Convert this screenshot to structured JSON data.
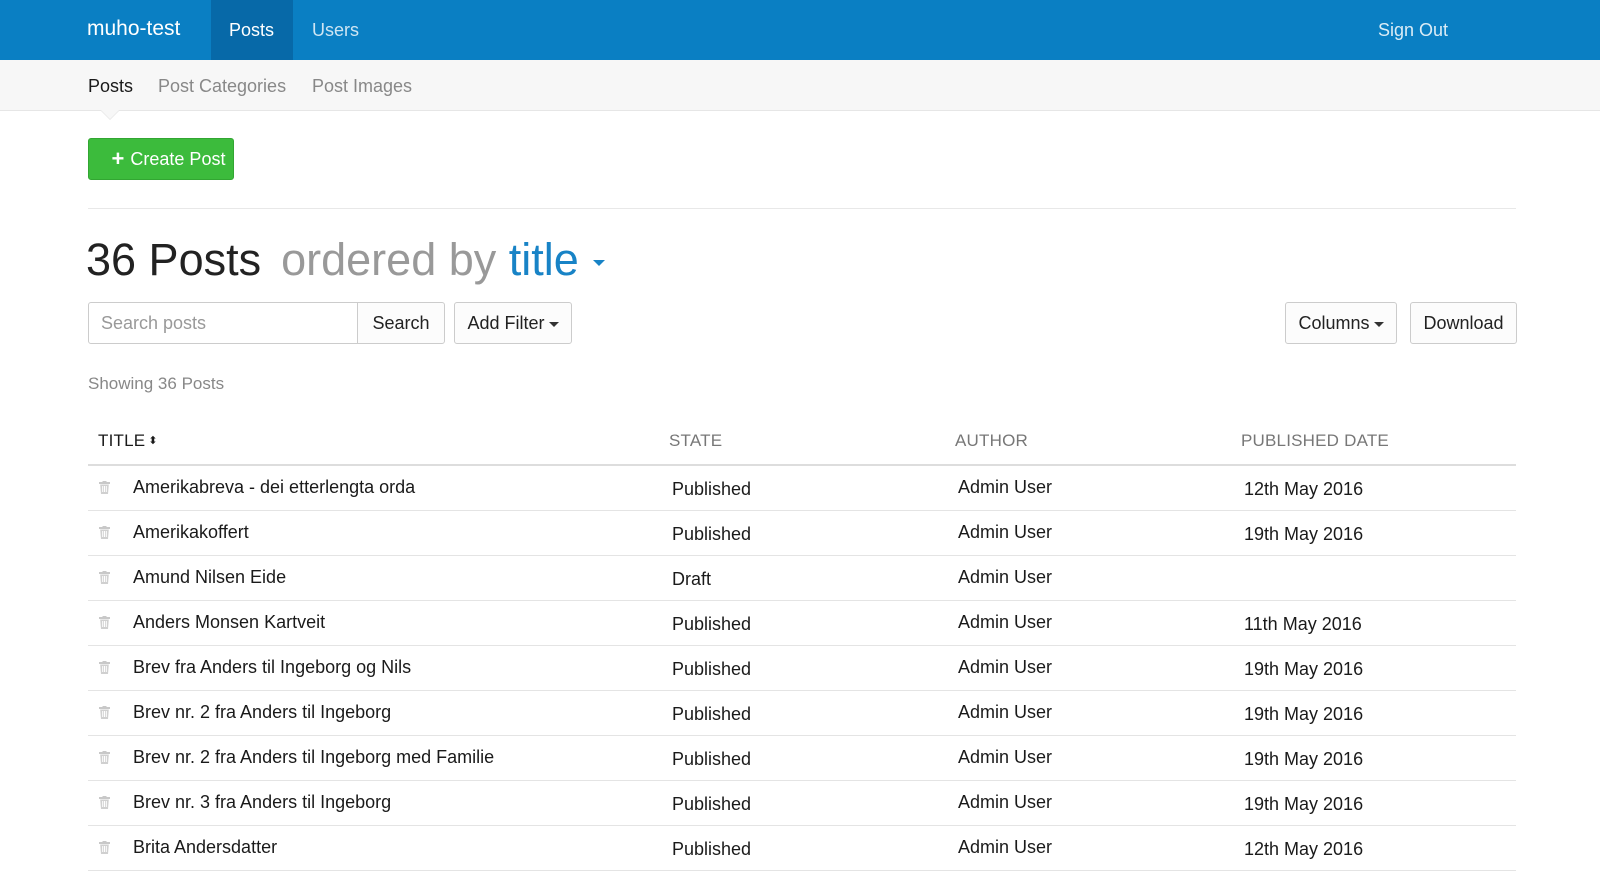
{
  "topbar": {
    "brand": "muho-test",
    "nav": [
      {
        "label": "Posts",
        "active": true
      },
      {
        "label": "Users",
        "active": false
      }
    ],
    "sign_out": "Sign Out",
    "color": "#0a7fc3"
  },
  "subnav": {
    "items": [
      {
        "label": "Posts",
        "active": true
      },
      {
        "label": "Post Categories",
        "active": false
      },
      {
        "label": "Post Images",
        "active": false
      }
    ]
  },
  "toolbar": {
    "create_label": "Create Post",
    "create_color": "#3cbb3c"
  },
  "heading": {
    "count_text": "36 Posts",
    "ordered_text": "ordered by",
    "sort_field": "title"
  },
  "search": {
    "placeholder": "Search posts",
    "value": "",
    "button_label": "Search",
    "add_filter_label": "Add Filter",
    "columns_label": "Columns",
    "download_label": "Download"
  },
  "list": {
    "showing": "Showing 36 Posts",
    "columns": [
      "TITLE",
      "STATE",
      "AUTHOR",
      "PUBLISHED DATE"
    ],
    "rows": [
      {
        "title": "Amerikabreva - dei etterlengta orda",
        "state": "Published",
        "author": "Admin User",
        "date": "12th May 2016"
      },
      {
        "title": "Amerikakoffert",
        "state": "Published",
        "author": "Admin User",
        "date": "19th May 2016"
      },
      {
        "title": "Amund Nilsen Eide",
        "state": "Draft",
        "author": "Admin User",
        "date": ""
      },
      {
        "title": "Anders Monsen Kartveit",
        "state": "Published",
        "author": "Admin User",
        "date": "11th May 2016"
      },
      {
        "title": "Brev fra Anders til Ingeborg og Nils",
        "state": "Published",
        "author": "Admin User",
        "date": "19th May 2016"
      },
      {
        "title": "Brev nr. 2 fra Anders til Ingeborg",
        "state": "Published",
        "author": "Admin User",
        "date": "19th May 2016"
      },
      {
        "title": "Brev nr. 2 fra Anders til Ingeborg med Familie",
        "state": "Published",
        "author": "Admin User",
        "date": "19th May 2016"
      },
      {
        "title": "Brev nr. 3 fra Anders til Ingeborg",
        "state": "Published",
        "author": "Admin User",
        "date": "19th May 2016"
      },
      {
        "title": "Brita Andersdatter",
        "state": "Published",
        "author": "Admin User",
        "date": "12th May 2016"
      }
    ]
  }
}
